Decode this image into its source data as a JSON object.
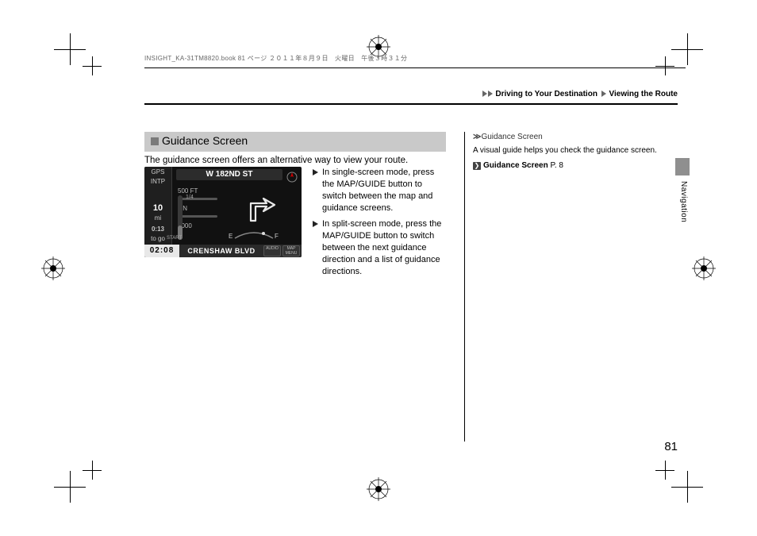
{
  "running_header": "INSIGHT_KA-31TM8820.book  81 ページ  ２０１１年８月９日　火曜日　午後３時３１分",
  "breadcrumb": {
    "a": "Driving to Your Destination",
    "b": "Viewing the Route"
  },
  "section_heading": "Guidance Screen",
  "intro": "The guidance screen offers an alternative way to view your route.",
  "nav_shot": {
    "street": "W 182ND ST",
    "gps_top": "GPS",
    "gps_bot": "INTP",
    "trip_dist": "10",
    "trip_unit": "mi",
    "trip_eta": "0:13",
    "trip_togo": "to go",
    "scale_top": "500 FT",
    "scale_on": "ON",
    "scale_1000": "1000",
    "clock": "02:08",
    "road": "CRENSHAW BLVD",
    "btn_audio": "AUDIO",
    "btn_map": "MAP\nMENU",
    "vbar_top": "1/4",
    "vbar_bot": "START",
    "gauge_e": "E",
    "gauge_f": "F"
  },
  "instructions": [
    "In single-screen mode, press the MAP/GUIDE button to switch between the map and guidance screens.",
    "In split-screen mode, press the MAP/GUIDE button to switch between the next guidance direction and a list of guidance directions."
  ],
  "note": {
    "title": "Guidance Screen",
    "body": "A visual guide helps you check the guidance screen.",
    "link_text": "Guidance Screen",
    "link_page": "P. 8"
  },
  "section_label": "Navigation",
  "page_number": "81"
}
